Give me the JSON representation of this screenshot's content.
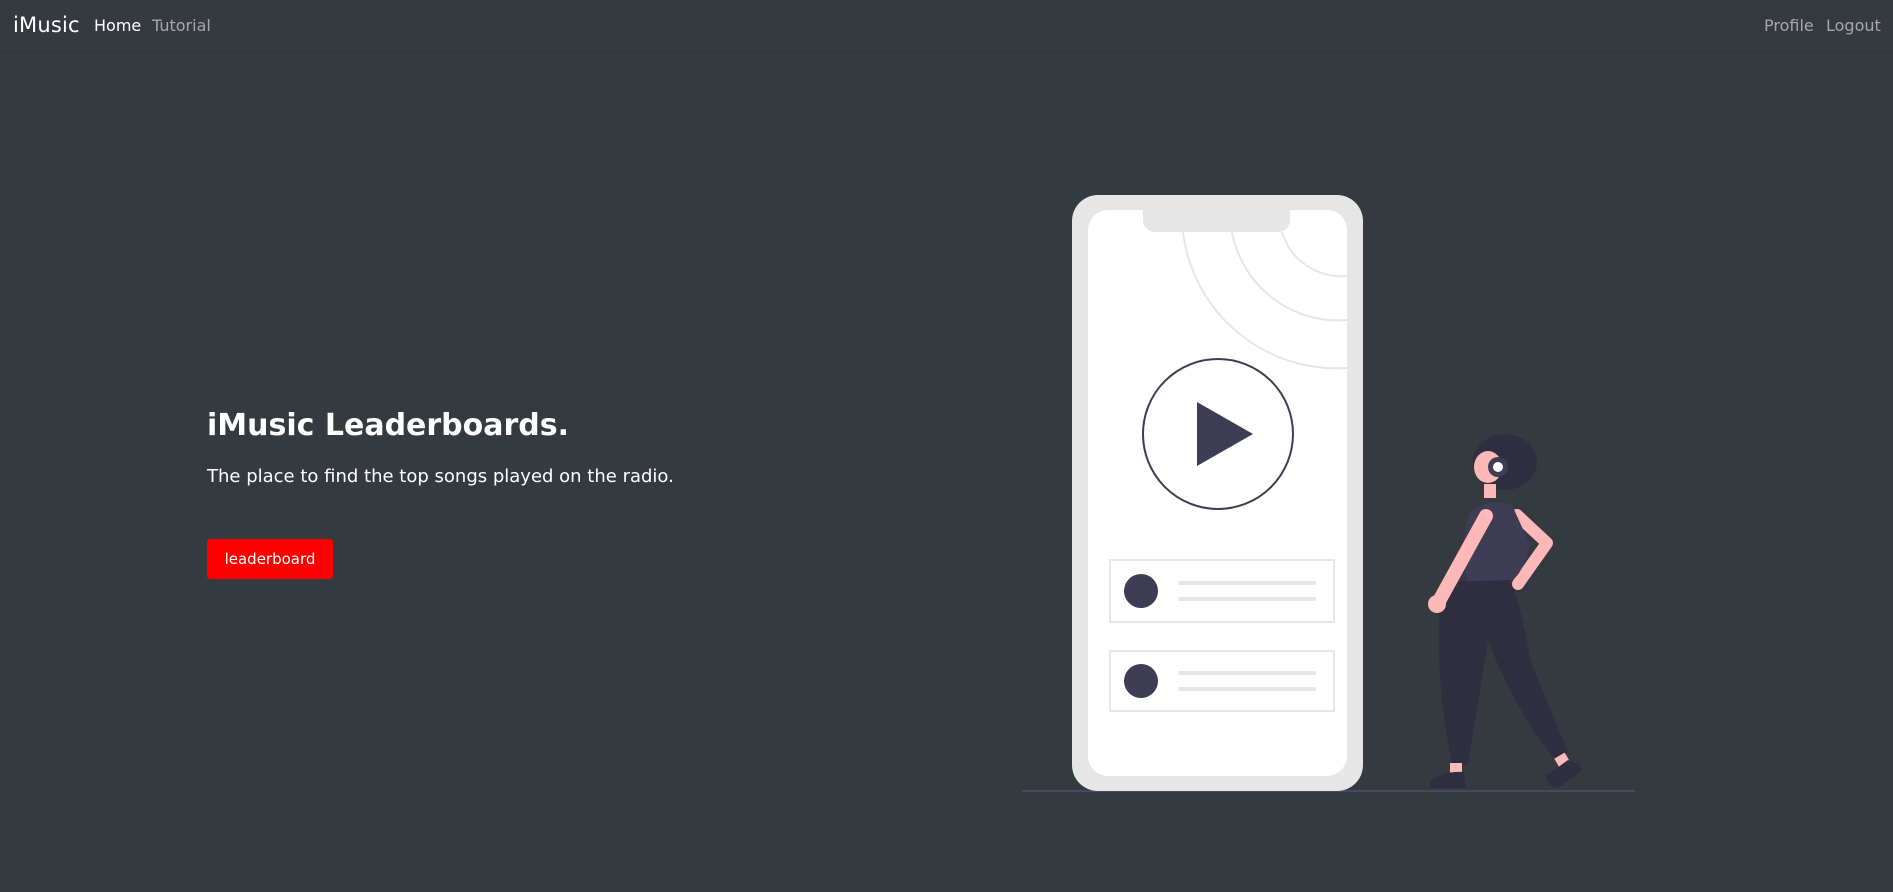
{
  "navbar": {
    "brand": "iMusic",
    "links": [
      {
        "label": "Home",
        "active": true
      },
      {
        "label": "Tutorial",
        "active": false
      }
    ],
    "right_links": [
      {
        "label": "Profile"
      },
      {
        "label": "Logout"
      }
    ]
  },
  "hero": {
    "title": "iMusic Leaderboards.",
    "subtitle": "The place to find the top songs played on the radio.",
    "button_label": "leaderboard"
  },
  "colors": {
    "background": "#343a40",
    "accent_button": "#ff0000",
    "illustration_dark": "#3f3d56",
    "illustration_skin": "#ffb8b8"
  },
  "icons": [
    "play-icon",
    "headphones-icon"
  ]
}
